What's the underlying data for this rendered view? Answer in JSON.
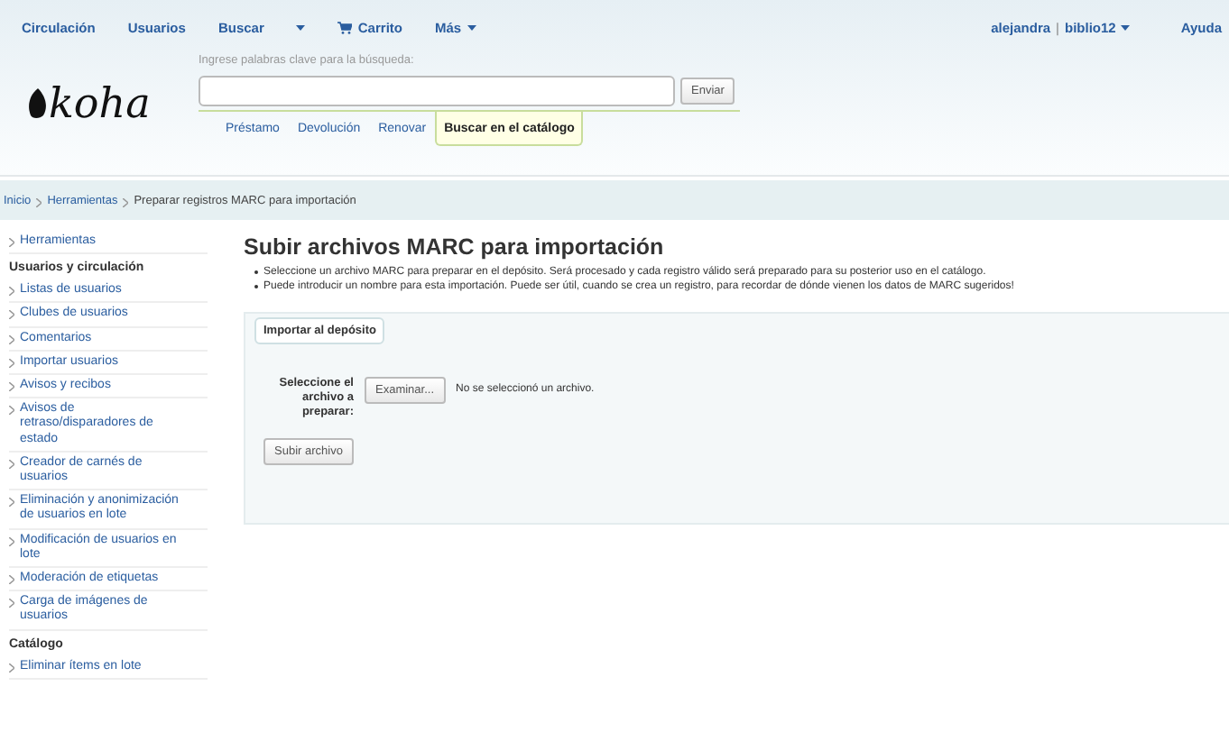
{
  "top_nav": {
    "items": [
      {
        "label": "Circulación",
        "kind": "link"
      },
      {
        "label": "Usuarios",
        "kind": "link"
      },
      {
        "label": "Buscar",
        "kind": "link"
      },
      {
        "kind": "caret"
      },
      {
        "label": "Carrito",
        "kind": "cart"
      },
      {
        "label": "Más",
        "kind": "menu"
      }
    ],
    "user": "alejandra",
    "branch": "biblio12",
    "separator": "|",
    "help": "Ayuda"
  },
  "logo": "koha",
  "search": {
    "label": "Ingrese palabras clave para la búsqueda:",
    "button": "Enviar"
  },
  "search_tabs": [
    {
      "label": "Préstamo",
      "selected": false
    },
    {
      "label": "Devolución",
      "selected": false
    },
    {
      "label": "Renovar",
      "selected": false
    },
    {
      "label": "Buscar en el catálogo",
      "selected": true
    }
  ],
  "breadcrumbs": [
    "Inicio",
    "Herramientas",
    "Preparar registros MARC para importación"
  ],
  "sidebar": [
    {
      "kind": "link",
      "label": "Herramientas"
    },
    {
      "kind": "heading",
      "label": "Usuarios y circulación"
    },
    {
      "kind": "link",
      "label": "Listas de usuarios"
    },
    {
      "kind": "link",
      "label": "Clubes de usuarios"
    },
    {
      "kind": "link",
      "label": "Comentarios"
    },
    {
      "kind": "link",
      "label": "Importar usuarios"
    },
    {
      "kind": "link",
      "label": "Avisos y recibos"
    },
    {
      "kind": "link",
      "label": "Avisos de retraso/disparadores de estado"
    },
    {
      "kind": "link",
      "label": "Creador de carnés de usuarios"
    },
    {
      "kind": "link",
      "label": "Eliminación y anonimización de usuarios en lote"
    },
    {
      "kind": "link",
      "label": "Modificación de usuarios en lote"
    },
    {
      "kind": "link",
      "label": "Moderación de etiquetas"
    },
    {
      "kind": "link",
      "label": "Carga de imágenes de usuarios"
    },
    {
      "kind": "heading",
      "label": "Catálogo"
    },
    {
      "kind": "link",
      "label": "Eliminar ítems en lote"
    }
  ],
  "main": {
    "title": "Subir archivos MARC para importación",
    "bullets": [
      "Seleccione un archivo MARC para preparar en el depósito. Será procesado y cada registro válido será preparado para su posterior uso en el catálogo.",
      "Puede introducir un nombre para esta importación. Puede ser útil, cuando se crea un registro, para recordar de dónde vienen los datos de MARC sugeridos!"
    ],
    "fieldset": {
      "legend": "Importar al depósito",
      "file_label": "Seleccione el archivo a preparar:",
      "browse_button": "Examinar...",
      "file_status": "No se seleccionó un archivo.",
      "submit": "Subir archivo"
    }
  }
}
